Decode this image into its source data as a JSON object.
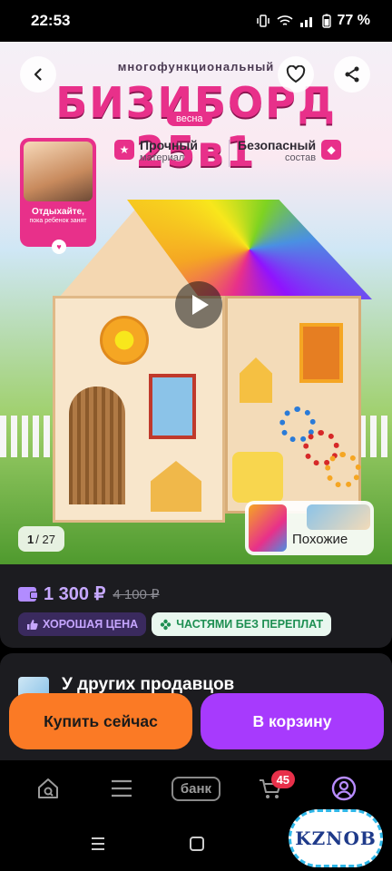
{
  "status_bar": {
    "time": "22:53",
    "battery": "77 %"
  },
  "hero": {
    "title_small": "многофункциональный",
    "title_big": "БИЗИБОРД 25в1",
    "spring_tag": "весна",
    "feature1": {
      "title": "Прочный",
      "subtitle": "материал"
    },
    "feature2": {
      "title": "Безопасный",
      "subtitle": "состав"
    },
    "promo": {
      "title": "Отдыхайте,",
      "subtitle": "пока ребенок занят"
    },
    "counter_current": "1",
    "counter_total": "/ 27",
    "similar_label": "Похожие"
  },
  "price": {
    "current": "1 300 ₽",
    "old": "4 100 ₽",
    "badge_good": "ХОРОШАЯ ЦЕНА",
    "badge_parts": "ЧАСТЯМИ БЕЗ ПЕРЕПЛАТ"
  },
  "sellers": {
    "title": "У других продавцов"
  },
  "actions": {
    "buy_now": "Купить сейчас",
    "to_cart": "В корзину"
  },
  "tabbar": {
    "bank_label": "банк",
    "cart_count": "45"
  },
  "watermark": "KZNOB",
  "colors": {
    "accent_purple": "#a73afd",
    "accent_orange": "#fb7a25",
    "price_purple": "#c7a9ff",
    "brand_pink": "#e8308a"
  }
}
